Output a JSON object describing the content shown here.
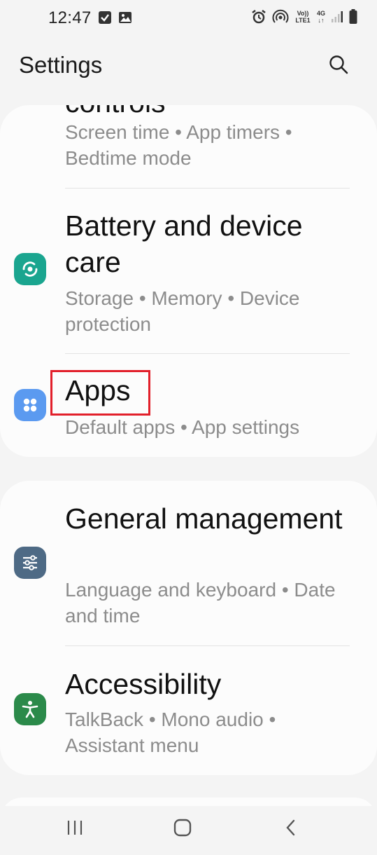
{
  "status_bar": {
    "time": "12:47",
    "left_icons": [
      "checkbox-notification-icon",
      "gallery-notification-icon"
    ],
    "right_icons": [
      "alarm-icon",
      "hotspot-icon",
      "volte-icon",
      "4g-icon",
      "signal-icon",
      "battery-icon"
    ],
    "volte_label": "Vo)) LTE1",
    "network_label": "4G"
  },
  "header": {
    "title": "Settings",
    "search_icon": "search-icon"
  },
  "groups": [
    {
      "items": [
        {
          "title": "controls",
          "subtitle": "Screen time  •  App timers  •  Bedtime mode",
          "icon": "",
          "icon_color": ""
        },
        {
          "title": "Battery and device care",
          "subtitle": "Storage  •  Memory  •  Device protection",
          "icon": "device-care-icon",
          "icon_color": "#1aa58f"
        },
        {
          "title": "Apps",
          "subtitle": "Default apps  •  App settings",
          "icon": "apps-icon",
          "icon_color": "#5b9af0"
        }
      ]
    },
    {
      "items": [
        {
          "title": "General management",
          "subtitle": "Language and keyboard  •  Date and time",
          "icon": "general-management-icon",
          "icon_color": "#4e6a85"
        },
        {
          "title": "Accessibility",
          "subtitle": "TalkBack  •  Mono audio  •  Assistant menu",
          "icon": "accessibility-icon",
          "icon_color": "#2b8a4a"
        }
      ]
    }
  ],
  "highlight_color": "#e2202b",
  "nav_bar": {
    "buttons": [
      "recent-apps-icon",
      "home-icon",
      "back-icon"
    ]
  }
}
